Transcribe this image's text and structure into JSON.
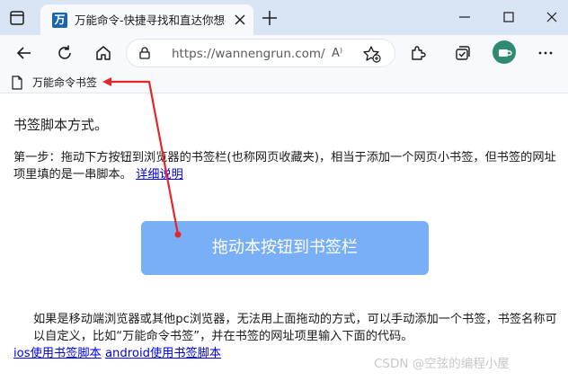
{
  "browser": {
    "tab_title": "万能命令-快捷寻找和直达你想要",
    "tab_favicon": "万",
    "url": "https://wannengrun.com/...",
    "read_aloud": "A",
    "accent": "#1b65ac"
  },
  "bookmarks_bar": {
    "items": [
      {
        "label": "万能命令书签",
        "icon": "page-icon"
      }
    ]
  },
  "page": {
    "heading": "书签脚本方式。",
    "step_text": "第一步：拖动下方按钮到浏览器的书签栏(也称网页收藏夹)，相当于添加一个网页小书签，但书签的网址项里填的是一串脚本。",
    "detail_link": "详细说明",
    "drag_button": "拖动本按钮到书签栏",
    "button_color": "#78aff7",
    "mobile_text": "如果是移动端浏览器或其他pc浏览器，无法用上面拖动的方式，可以手动添加一个书签，书签名称可以自定义，比如“万能命令书签”，并在书签的网址项里输入下面的代码。",
    "ios_link": "ios使用书签脚本",
    "android_link": "android使用书签脚本"
  },
  "watermark": "CSDN @空弦的编程小屋",
  "annotation": {
    "arrow_color": "#e5262a"
  }
}
